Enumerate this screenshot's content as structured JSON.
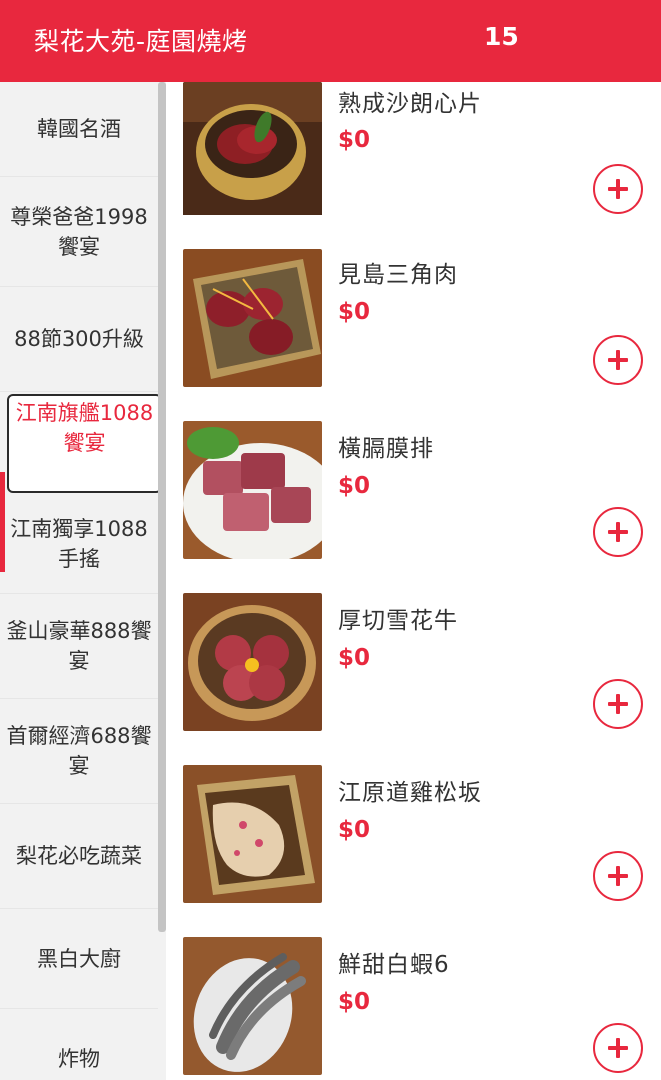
{
  "header": {
    "title": "梨花大苑-庭園燒烤",
    "count": "15"
  },
  "sidebar": {
    "items": [
      {
        "label": "韓國名酒"
      },
      {
        "label": "尊榮爸爸1998饗宴"
      },
      {
        "label": "88節300升級"
      },
      {
        "label": "江南旗艦1088饗宴",
        "active": true
      },
      {
        "label": "江南獨享1088手搖"
      },
      {
        "label": "釜山豪華888饗宴"
      },
      {
        "label": "首爾經濟688饗宴"
      },
      {
        "label": "梨花必吃蔬菜"
      },
      {
        "label": "黑白大廚"
      },
      {
        "label": "炸物"
      }
    ]
  },
  "menu": {
    "items": [
      {
        "name": "熟成沙朗心片",
        "price": "$0",
        "image": "beef-slices-in-bowl"
      },
      {
        "name": "見島三角肉",
        "price": "$0",
        "image": "beef-on-tray"
      },
      {
        "name": "橫膈膜排",
        "price": "$0",
        "image": "beef-cubes-on-plate"
      },
      {
        "name": "厚切雪花牛",
        "price": "$0",
        "image": "beef-flower-bowl"
      },
      {
        "name": "江原道雞松坂",
        "price": "$0",
        "image": "chicken-in-tray"
      },
      {
        "name": "鮮甜白蝦6",
        "price": "$0",
        "image": "shrimp-on-plate"
      }
    ]
  },
  "colors": {
    "accent": "#e8283e",
    "sidebar_bg": "#f2f2f2"
  },
  "icons": {
    "add": "plus-circle-icon"
  }
}
